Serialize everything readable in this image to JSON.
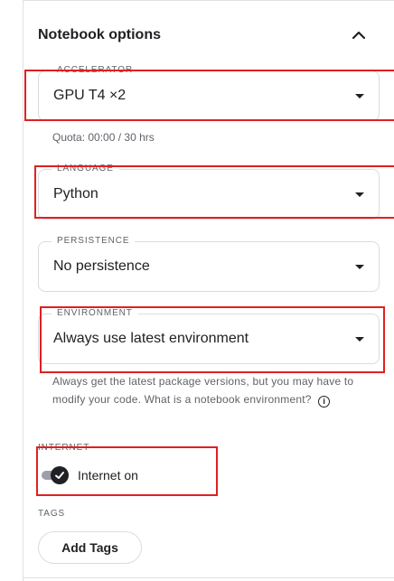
{
  "section": {
    "title": "Notebook options"
  },
  "accelerator": {
    "label": "ACCELERATOR",
    "value": "GPU T4 ×2",
    "quota": "Quota: 00:00 / 30 hrs"
  },
  "language": {
    "label": "LANGUAGE",
    "value": "Python"
  },
  "persistence": {
    "label": "PERSISTENCE",
    "value": "No persistence"
  },
  "environment": {
    "label": "ENVIRONMENT",
    "value": "Always use latest environment",
    "help": "Always get the latest package versions, but you may have to modify your code. What is a notebook environment?"
  },
  "internet": {
    "label": "INTERNET",
    "toggle_label": "Internet on",
    "enabled": true
  },
  "tags": {
    "label": "TAGS",
    "button": "Add Tags"
  },
  "colors": {
    "highlight": "#e02020",
    "toggle_on": "#202124"
  }
}
